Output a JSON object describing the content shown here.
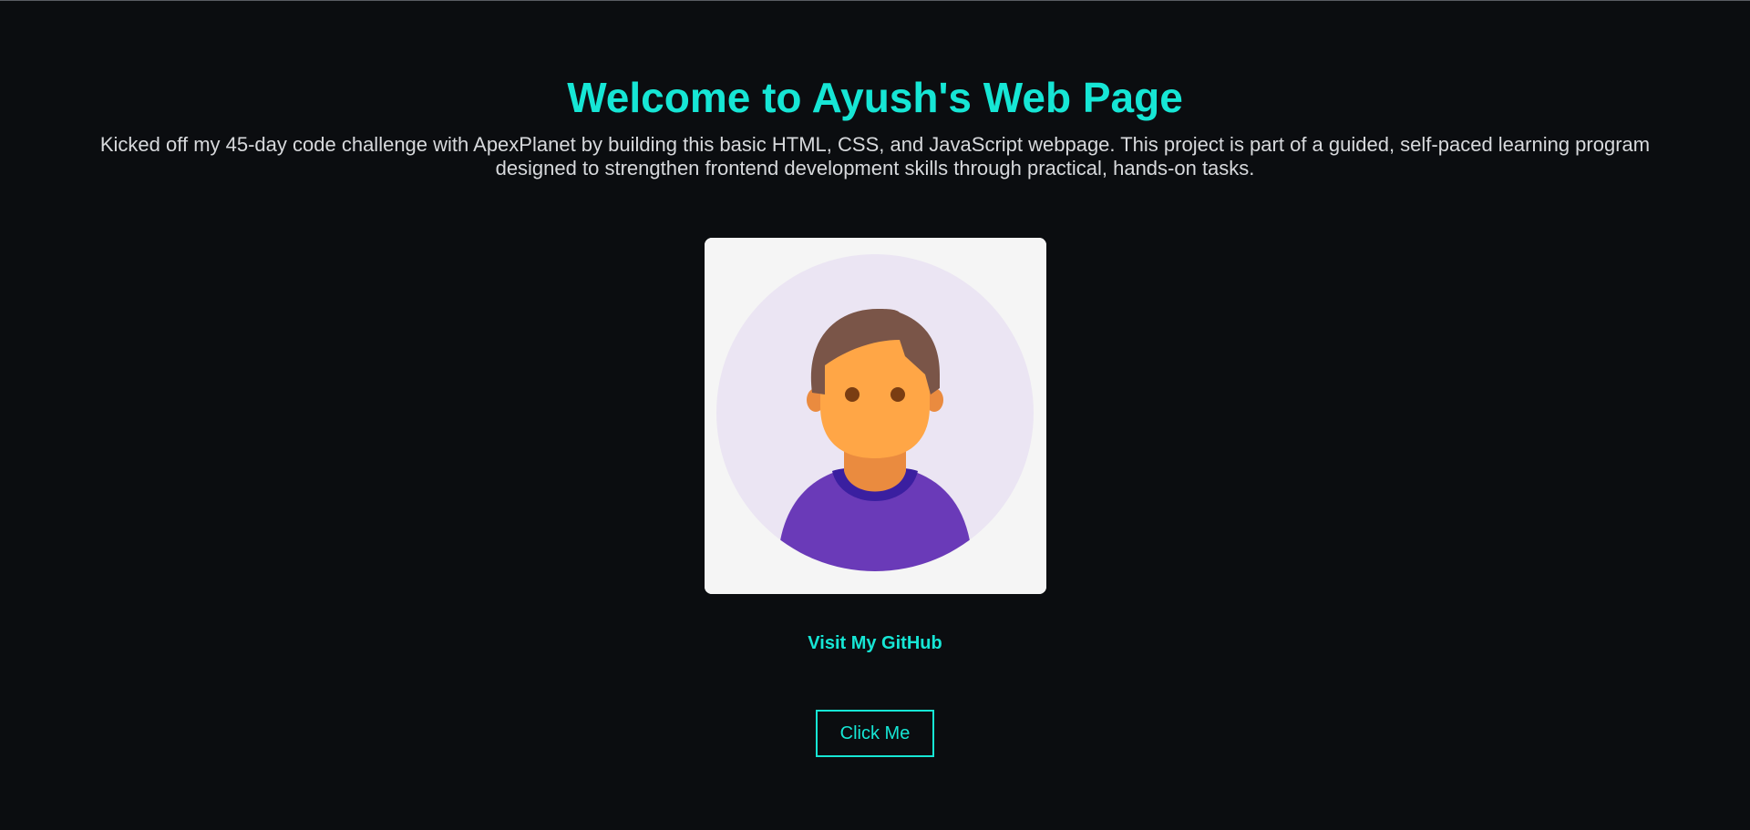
{
  "header": {
    "title": "Welcome to Ayush's Web Page",
    "intro": "Kicked off my 45-day code challenge with ApexPlanet by building this basic HTML, CSS, and JavaScript webpage. This project is part of a guided, self-paced learning program designed to strengthen frontend development skills through practical, hands-on tasks."
  },
  "profile": {
    "image_icon": "user-avatar-illustration"
  },
  "links": {
    "github_label": "Visit My GitHub"
  },
  "actions": {
    "click_label": "Click Me"
  },
  "colors": {
    "background": "#0b0d10",
    "accent": "#16e6d5",
    "text": "#d7d9dc",
    "card": "#f5f5f5",
    "avatar_circle": "#ebe5f3",
    "hair": "#7a5548",
    "skin": "#ffa646",
    "neck": "#ea8b3f",
    "shirt": "#6a3ab8",
    "collar": "#3a1fa0"
  }
}
